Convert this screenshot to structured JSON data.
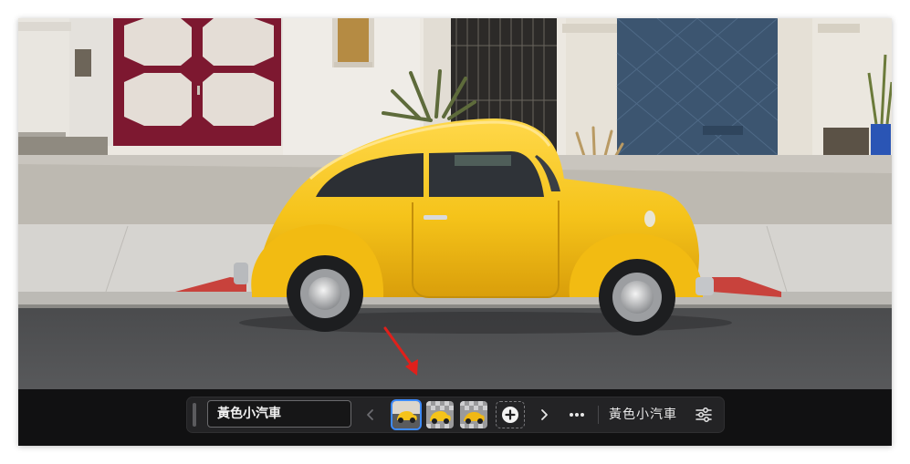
{
  "toolbar": {
    "prompt_value": "黃色小汽車",
    "layer_name": "黃色小汽車",
    "variation_count": 3,
    "selected_variation_index": 0
  },
  "icons": {
    "drag_handle": "drag-handle-icon",
    "previous": "chevron-left-icon",
    "next": "chevron-right-icon",
    "add": "plus-circle-icon",
    "more": "more-horizontal-icon",
    "settings": "sliders-icon",
    "annotation": "red-arrow-icon"
  },
  "colors": {
    "toolbar_background": "#232325",
    "selection_accent": "#3d8bff",
    "annotation_arrow": "#e0201b",
    "car_yellow": "#f5c31a"
  }
}
